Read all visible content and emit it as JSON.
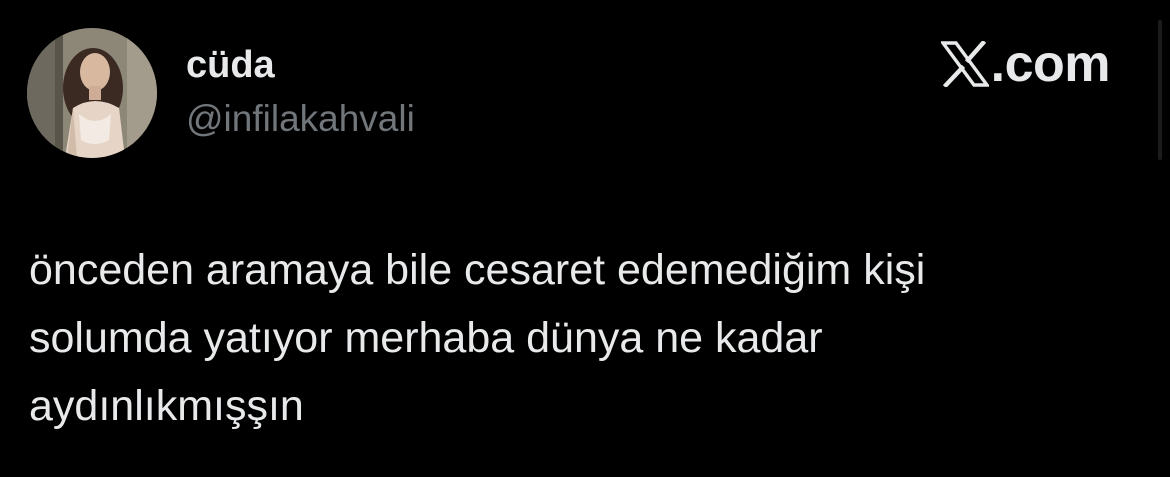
{
  "user": {
    "display_name": "cüda",
    "handle": "@infilakahvali"
  },
  "brand": {
    "icon": "x-logo-icon",
    "suffix": ".com"
  },
  "tweet": {
    "text": "önceden aramaya bile cesaret edemediğim kişi\nsolumda yatıyor merhaba dünya ne kadar\naydınlıkmışşın"
  },
  "colors": {
    "background": "#000000",
    "primary_text": "#e7e9ea",
    "secondary_text": "#71767b"
  }
}
